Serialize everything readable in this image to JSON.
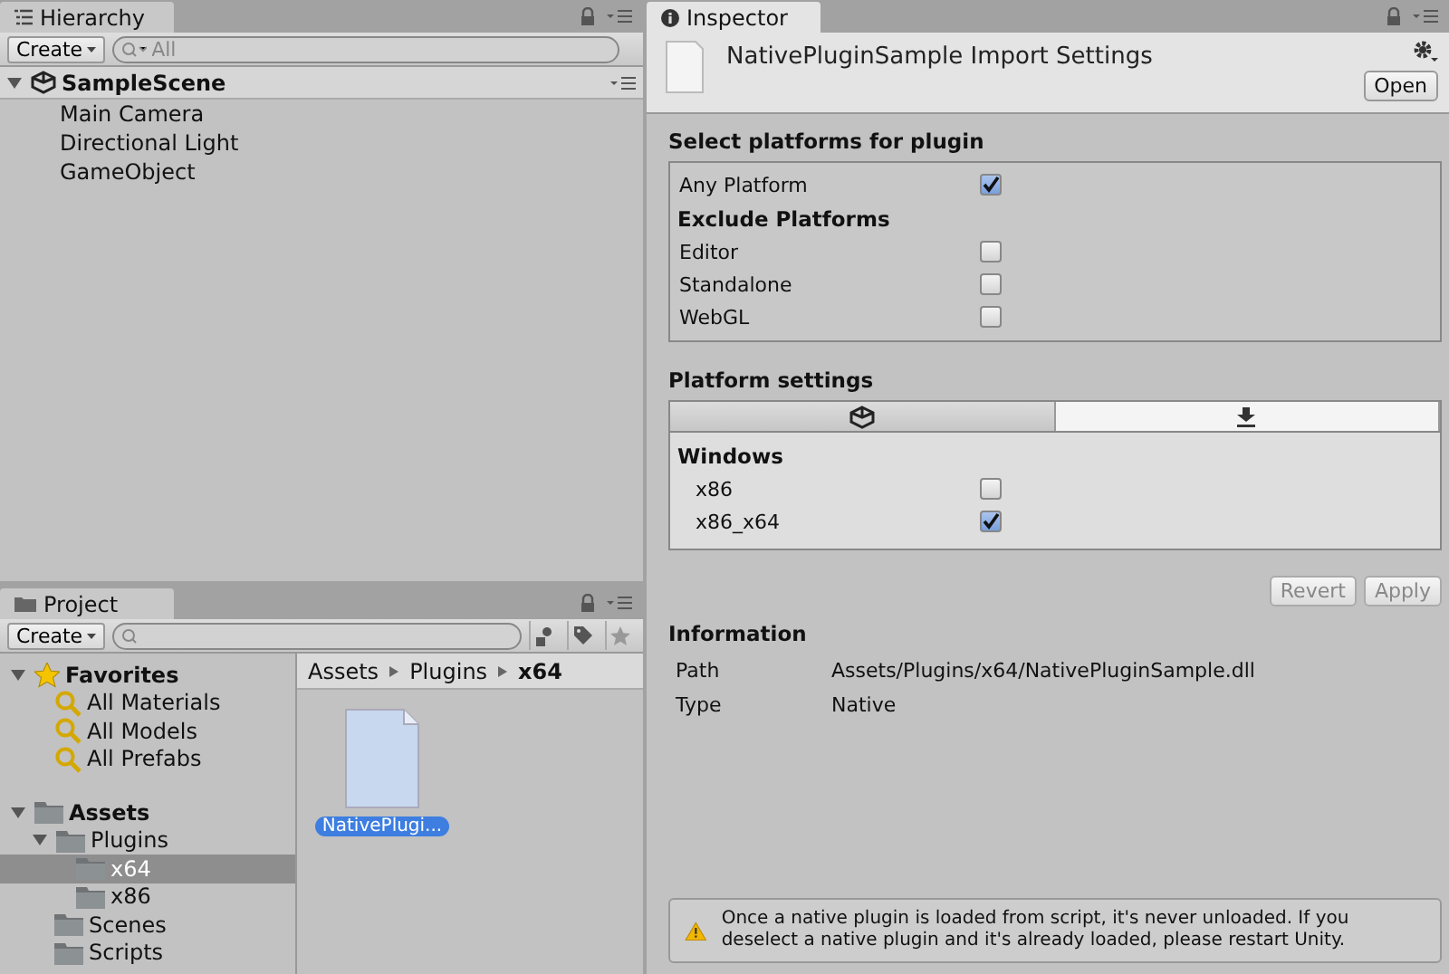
{
  "hierarchy": {
    "tab": "Hierarchy",
    "create": "Create",
    "search_placeholder": "All",
    "scene": {
      "label": "SampleScene",
      "expanded": true
    },
    "items": [
      {
        "label": "Main Camera"
      },
      {
        "label": "Directional Light"
      },
      {
        "label": "GameObject"
      }
    ]
  },
  "project": {
    "tab": "Project",
    "create": "Create",
    "favorites": {
      "label": "Favorites",
      "expanded": true,
      "items": [
        {
          "label": "All Materials"
        },
        {
          "label": "All Models"
        },
        {
          "label": "All Prefabs"
        }
      ]
    },
    "tree": [
      {
        "label": "Assets",
        "expanded": true,
        "selected": false,
        "children": [
          {
            "label": "Plugins",
            "expanded": true,
            "selected": false,
            "children": [
              {
                "label": "x64",
                "selected": true
              },
              {
                "label": "x86",
                "selected": false
              }
            ]
          },
          {
            "label": "Scenes",
            "selected": false
          },
          {
            "label": "Scripts",
            "selected": false
          }
        ]
      }
    ],
    "breadcrumb": [
      "Assets",
      "Plugins",
      "x64"
    ],
    "files": [
      {
        "name": "NativePlugi...",
        "selected": true
      }
    ]
  },
  "inspector": {
    "tab": "Inspector",
    "title": "NativePluginSample Import Settings",
    "open_button": "Open",
    "select_heading": "Select platforms for plugin",
    "any_platform": {
      "label": "Any Platform",
      "checked": true
    },
    "exclude_heading": "Exclude Platforms",
    "platforms": [
      {
        "label": "Editor",
        "checked": false
      },
      {
        "label": "Standalone",
        "checked": false
      },
      {
        "label": "WebGL",
        "checked": false
      }
    ],
    "settings_heading": "Platform settings",
    "platform_tabs": [
      {
        "kind": "unity",
        "selected": false
      },
      {
        "kind": "download",
        "selected": true
      }
    ],
    "section": "Windows",
    "options": [
      {
        "label": "x86",
        "checked": false
      },
      {
        "label": "x86_x64",
        "checked": true
      }
    ],
    "buttons": [
      {
        "label": "Revert",
        "disabled": true
      },
      {
        "label": "Apply",
        "disabled": true
      }
    ],
    "info_heading": "Information",
    "info": [
      {
        "key": "Path",
        "value": "Assets/Plugins/x64/NativePluginSample.dll"
      },
      {
        "key": "Type",
        "value": "Native"
      }
    ],
    "warning": "Once a native plugin is loaded from script, it's never unloaded. If you deselect a native plugin and it's already loaded, please restart Unity."
  }
}
